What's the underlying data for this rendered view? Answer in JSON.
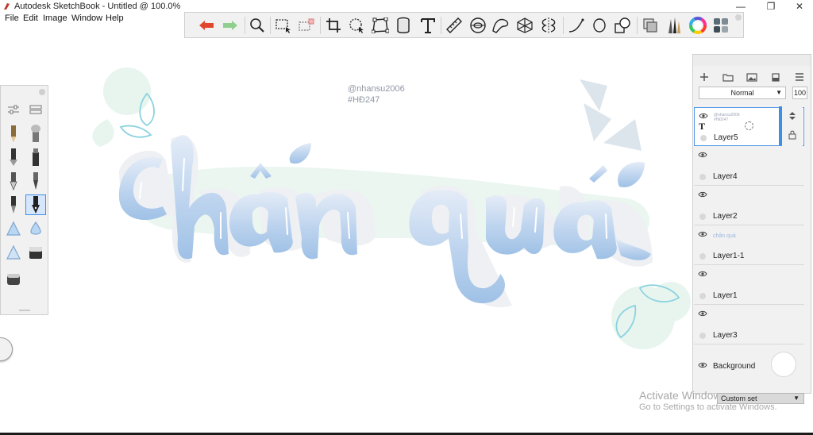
{
  "window": {
    "title": "Autodesk SketchBook - Untitled @ 100.0%",
    "minimize": "—",
    "maximize": "❐",
    "close": "✕"
  },
  "menu": [
    "File",
    "Edit",
    "Image",
    "Window",
    "Help"
  ],
  "toolbar": {
    "tools": [
      "undo-icon",
      "redo-icon",
      "zoom-icon",
      "select-icon",
      "transform-select-icon",
      "crop-icon",
      "lasso-icon",
      "distort-icon",
      "fill-icon",
      "text-icon",
      "ruler-icon",
      "ellipse-guide-icon",
      "french-curve-icon",
      "perspective-icon",
      "symmetry-icon",
      "stroke-icon",
      "shape-icon",
      "copy-icon",
      "layers-icon",
      "brushes-icon",
      "color-wheel-icon",
      "copic-library-icon"
    ]
  },
  "canvas": {
    "watermark_user": "@nhansu2006",
    "watermark_tag": "#HĐ247",
    "colors": {
      "lettering_top": "#dfe8f5",
      "lettering_bottom": "#a9c8e9",
      "shadow": "#eef0f2",
      "drop_outline": "#7fd0de",
      "mint": "#e6f4ee",
      "grey_shape": "#dde4ea"
    }
  },
  "layers": {
    "blend_mode": "Normal",
    "opacity": "100",
    "items": [
      {
        "name": "Layer5",
        "thumb_line1": "@nhansu2006",
        "thumb_line2": "#HĐ247",
        "selected": true
      },
      {
        "name": "Layer4"
      },
      {
        "name": "Layer2"
      },
      {
        "name": "Layer1-1",
        "thumb_line1": "chân quá"
      },
      {
        "name": "Layer1"
      },
      {
        "name": "Layer3"
      },
      {
        "name": "Background"
      }
    ]
  },
  "brush_set": "Custom set",
  "activation": {
    "title": "Activate Windows",
    "subtitle": "Go to Settings to activate Windows."
  }
}
